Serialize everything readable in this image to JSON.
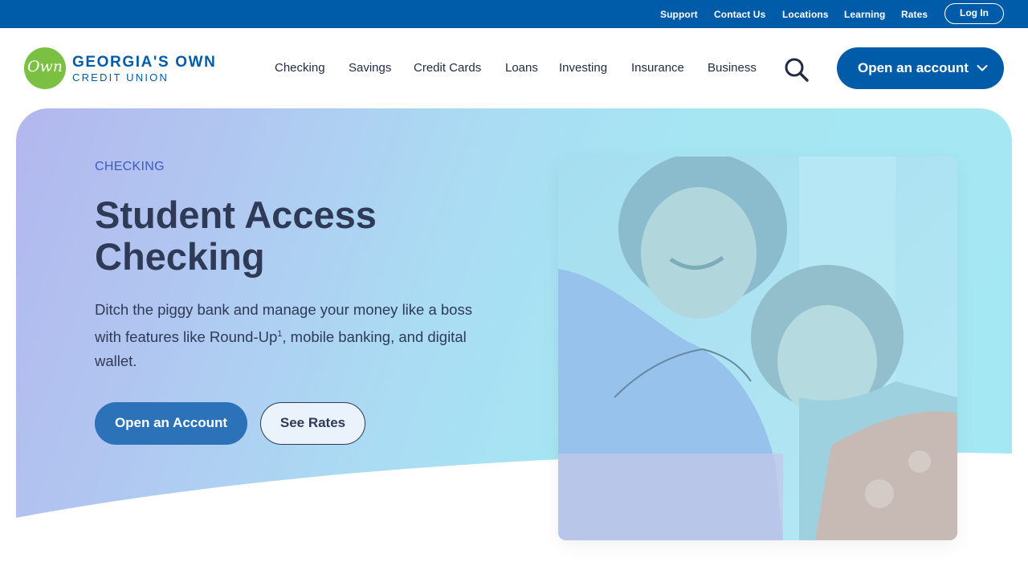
{
  "utility_nav": {
    "links": [
      "Support",
      "Contact Us",
      "Locations",
      "Learning",
      "Rates"
    ],
    "login_label": "Log In"
  },
  "header": {
    "logo": {
      "mark": "Own",
      "name_line1": "GEORGIA'S OWN",
      "name_line2": "CREDIT UNION"
    },
    "nav": [
      "Checking",
      "Savings",
      "Credit Cards",
      "Loans",
      "Investing",
      "Insurance",
      "Business"
    ],
    "search_icon": "search-icon",
    "cta_label": "Open an account",
    "cta_icon": "chevron-down-icon"
  },
  "hero": {
    "eyebrow": "CHECKING",
    "title": "Student Access Checking",
    "description_before": "Ditch the piggy bank and manage your money like a boss with features like Round-Up",
    "description_footnote": "1",
    "description_after": ", mobile banking, and digital wallet.",
    "primary_button": "Open an Account",
    "secondary_button": "See Rates"
  },
  "colors": {
    "brand_blue": "#005ca9",
    "logo_green": "#7ac143",
    "heading": "#2f3a57",
    "eyebrow": "#3d5cc4"
  }
}
